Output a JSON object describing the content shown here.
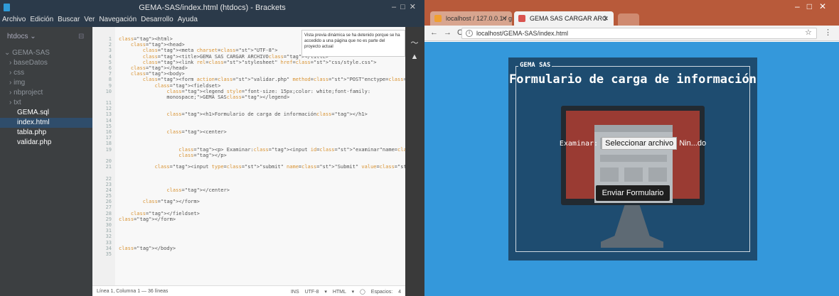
{
  "brackets": {
    "title": "GEMA-SAS/index.html (htdocs) - Brackets",
    "menu": [
      "Archivo",
      "Edición",
      "Buscar",
      "Ver",
      "Navegación",
      "Desarrollo",
      "Ayuda"
    ],
    "project_label": "htdocs",
    "tree": [
      {
        "label": "GEMA-SAS",
        "kind": "root"
      },
      {
        "label": "baseDatos",
        "kind": "folder"
      },
      {
        "label": "css",
        "kind": "folder"
      },
      {
        "label": "img",
        "kind": "folder"
      },
      {
        "label": "nbproject",
        "kind": "folder"
      },
      {
        "label": "txt",
        "kind": "folder"
      },
      {
        "label": "GEMA.sql",
        "kind": "file"
      },
      {
        "label": "index.html",
        "kind": "file-selected"
      },
      {
        "label": "tabla.php",
        "kind": "file"
      },
      {
        "label": "validar.php",
        "kind": "file"
      }
    ],
    "line_numbers": [
      "1",
      "2",
      "3",
      "4",
      "5",
      "6",
      "7",
      "8",
      "9",
      "10",
      "",
      "11",
      "12",
      "13",
      "14",
      "15",
      "16",
      "17",
      "18",
      "19",
      "",
      "20",
      "21",
      "",
      "22",
      "23",
      "24",
      "25",
      "26",
      "27",
      "28",
      "29",
      "30",
      "31",
      "32",
      "33",
      "34",
      "35"
    ],
    "code_lines": [
      "<html>",
      "    <head>",
      "        <meta charset=\"UTF-8\">",
      "        <title>GEMA SAS CARGAR ARCHIVO</title>",
      "        <link rel=\"stylesheet\" href=\"css/style.css\">",
      "    </head>",
      "    <body>",
      "        <form action=\"validar.php\" method=\"POST\"enctype=\"multipart/form-data\">",
      "            <fieldset>",
      "                <legend style=\"font-size: 15px;color: white;font-family:",
      "                monospace;\">GEMA SAS</legend>",
      "",
      "",
      "                <h1>Formulario de carga de información</h1>",
      "",
      "",
      "                <center>",
      "",
      "",
      "                    <p> Examinar:<input id=\"examinar\"name=\"csv\" type=\"file\" id=\"csv\"/>",
      "                    </p>",
      "",
      "            <input type=\"submit\" name=\"Submit\" value=\"Enviar Formulario\" id=\"boton\" />",
      "",
      "",
      "",
      "                </center>",
      "",
      "        </form>",
      "",
      "    </fieldset>",
      "</form>",
      "",
      "",
      "",
      "",
      "</body>",
      ""
    ],
    "tooltip": "Vista previa dinámica se ha detenido porque se ha accedido a una página que no es parte del proyecto actual",
    "status_left": "Línea 1, Columna 1 — 36 líneas",
    "status_right": [
      "INS",
      "UTF-8 ▾",
      "HTML ▾",
      "◯",
      "Espacios: 4"
    ]
  },
  "chrome": {
    "tab1": "localhost / 127.0.0.1 / ge",
    "tab2": "GEMA SAS CARGAR ARC",
    "url": "localhost/GEMA-SAS/index.html",
    "page": {
      "legend": "GEMA SAS",
      "heading": "Formulario de carga de información",
      "file_label": "Examinar:",
      "file_button": "Seleccionar archivo",
      "file_status": "Nin...do",
      "submit": "Enviar Formulario"
    }
  },
  "colors": {
    "chrome_tab_bar": "#b85a3a",
    "page_bg": "#3498db",
    "panel_bg": "#1e4c70"
  }
}
